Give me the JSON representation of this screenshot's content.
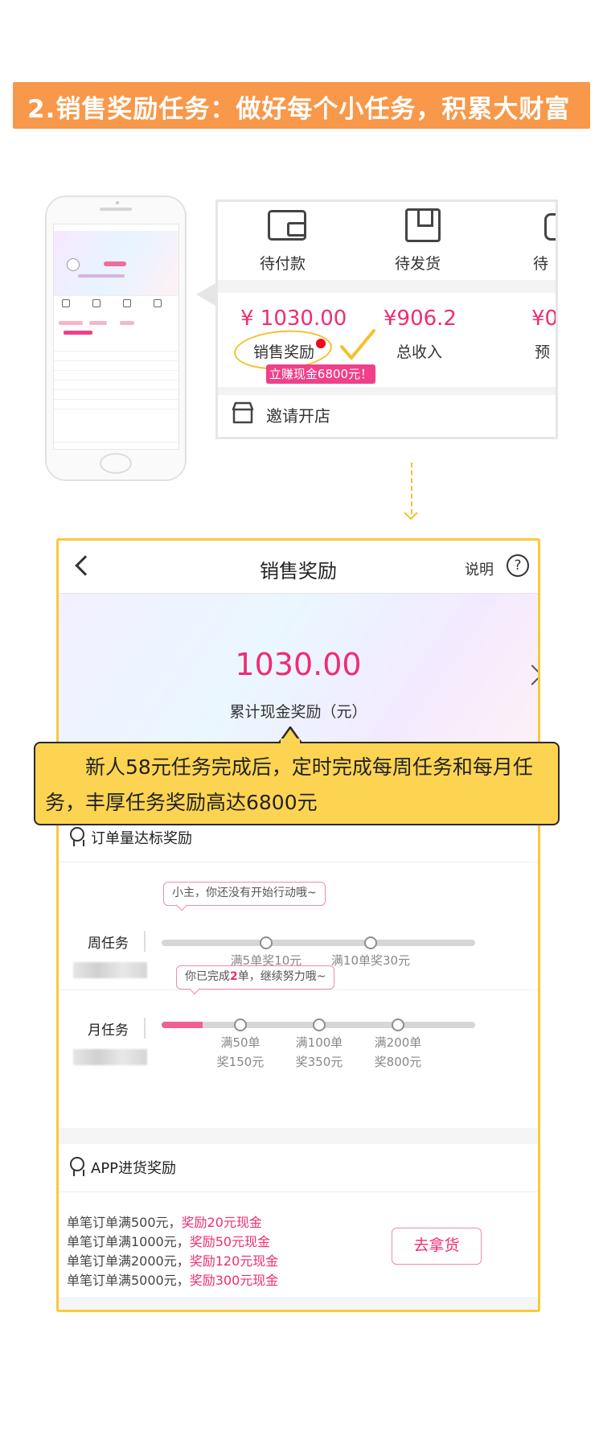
{
  "banner": {
    "title": "2.销售奖励任务：做好每个小任务，积累大财富"
  },
  "zoom": {
    "icons": [
      {
        "icon": "wallet-icon",
        "label": "待付款"
      },
      {
        "icon": "package-icon",
        "label": "待发货"
      },
      {
        "icon": "clipboard-icon",
        "label": "待"
      }
    ],
    "values": [
      {
        "value": "¥ 1030.00",
        "label": "销售奖励"
      },
      {
        "value": "¥906.2",
        "label": "总收入"
      },
      {
        "value": "¥0",
        "label": "预"
      }
    ],
    "badge": "立赚现金6800元！",
    "invite": "邀请开店"
  },
  "card": {
    "nav": {
      "title": "销售奖励",
      "help": "说明",
      "help_icon": "?"
    },
    "hero": {
      "amount": "1030.00",
      "amount_label": "累计现金奖励（元）"
    },
    "callout": "新人58元任务完成后，定时完成每周任务和每月任务，丰厚任务奖励高达6800元",
    "order_section": {
      "title": "订单量达标奖励",
      "weekly": {
        "label": "周任务",
        "tip": "小主，你还没有开始行动哦~",
        "progress": 0,
        "milestones": [
          "满5单奖10元",
          "满10单奖30元"
        ]
      },
      "monthly": {
        "label": "月任务",
        "tip_prefix": "你已完成",
        "tip_count": "2",
        "tip_suffix": "单，继续努力哦~",
        "progress": 0.13,
        "milestones": [
          {
            "line1": "满50单",
            "line2": "奖150元"
          },
          {
            "line1": "满100单",
            "line2": "奖350元"
          },
          {
            "line1": "满200单",
            "line2": "奖800元"
          }
        ]
      }
    },
    "app_section": {
      "title": "APP进货奖励",
      "rules": [
        {
          "text": "单笔订单满500元，",
          "reward": "奖励20元现金"
        },
        {
          "text": "单笔订单满1000元，",
          "reward": "奖励50元现金"
        },
        {
          "text": "单笔订单满2000元，",
          "reward": "奖励120元现金"
        },
        {
          "text": "单笔订单满5000元，",
          "reward": "奖励300元现金"
        }
      ],
      "button": "去拿货"
    }
  },
  "colors": {
    "accent": "#f02c73",
    "banner": "#f7984a",
    "callout": "#fdd452",
    "frame": "#f9c93b"
  }
}
